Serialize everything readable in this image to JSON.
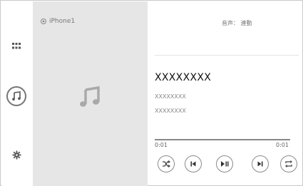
{
  "source": {
    "name": "iPhone1"
  },
  "header": {
    "audio_setting": "音声： 連動"
  },
  "track": {
    "title": "XXXXXXXX",
    "artist": "XXXXXXXX",
    "album": "XXXXXXXX"
  },
  "playback": {
    "elapsed": "0:01",
    "total": "0:01",
    "progress_fraction": 0.0
  },
  "icons": {
    "apps": "apps-grid-icon",
    "music": "music-note-icon",
    "settings": "gear-icon",
    "source": "source-radio-icon",
    "shuffle": "shuffle-icon",
    "previous": "previous-track-icon",
    "play_pause": "play-pause-icon",
    "next": "next-track-icon",
    "repeat": "repeat-icon"
  },
  "colors": {
    "panel_bg": "#e6e6e6",
    "icon_gray": "#777777"
  }
}
